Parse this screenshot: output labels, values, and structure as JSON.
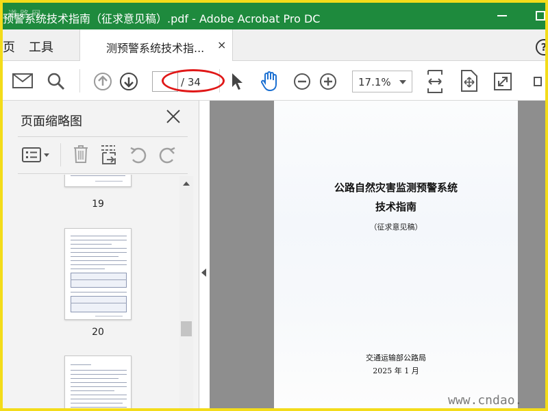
{
  "window": {
    "title": "预警系统技术指南（征求意见稿）.pdf - Adobe Acrobat Pro DC",
    "watermark_top_left": "道 路 网"
  },
  "tabs": {
    "home_partial": "页",
    "tools": "工具",
    "document": "测预警系统技术指...",
    "close_glyph": "×",
    "help_glyph": "?"
  },
  "toolbar": {
    "page_current": "",
    "page_total": "/ 34",
    "zoom": "17.1%"
  },
  "panel": {
    "title": "页面缩略图",
    "thumbnails": [
      {
        "number": "19"
      },
      {
        "number": "20"
      },
      {
        "number": ""
      }
    ]
  },
  "document": {
    "title_line1": "公路自然灾害监测预警系统",
    "title_line2": "技术指南",
    "subtitle": "（征求意见稿）",
    "organization": "交通运输部公路局",
    "date": "2025 年 1 月"
  },
  "watermark": "www.cndao.",
  "colors": {
    "titlebar": "#1e8a3d",
    "frame_border": "#f3dc1a",
    "annotation": "#e01818",
    "hand_tool": "#1a6fd1"
  }
}
